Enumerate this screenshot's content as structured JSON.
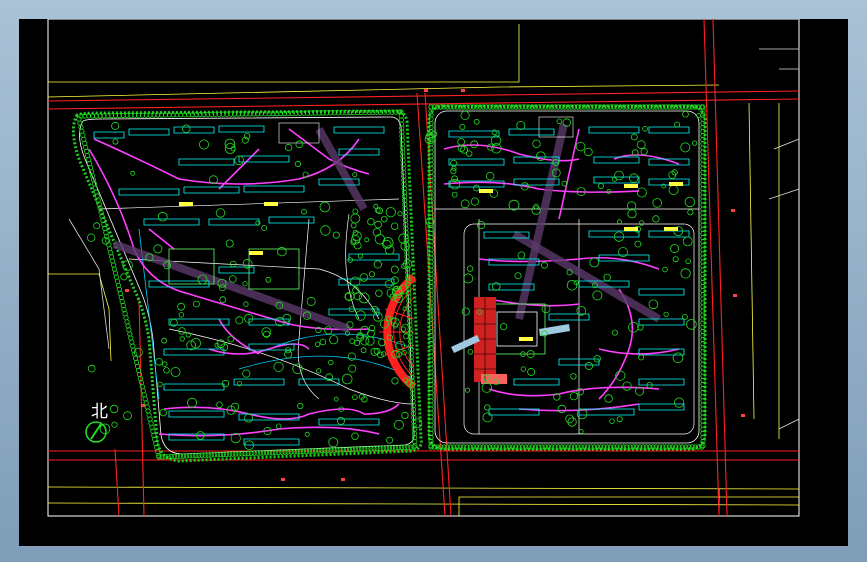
{
  "drawing": {
    "north_label": "北",
    "colors": {
      "background": "#000000",
      "road": "#ff2020",
      "block_outline": "#ffffff",
      "green": "#22cc22",
      "path": "#ff40ff",
      "building": "#00ffff",
      "landscape": "#ffff40",
      "frame": "#ffffff"
    }
  }
}
